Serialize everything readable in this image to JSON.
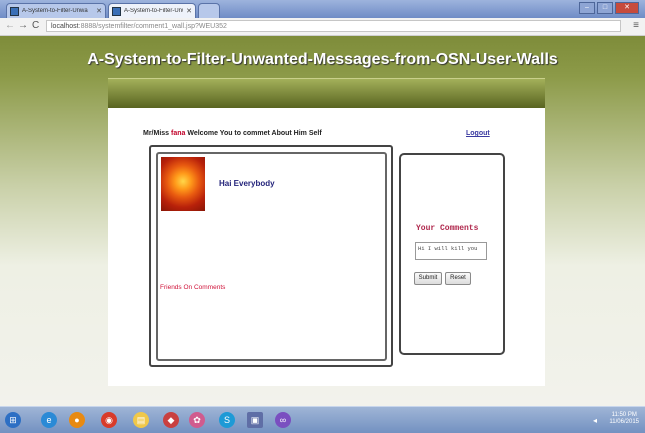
{
  "browser": {
    "tabs": [
      {
        "label": "A-System-to-Filter-Unwa"
      },
      {
        "label": "A-System-to-Filter-Unwa"
      },
      {
        "label": ""
      }
    ],
    "url_host": "localhost",
    "url_rest": ":8888/systemfilter/comment1_wall.jsp?WEU352"
  },
  "header": {
    "title": "A-System-to-Filter-Unwanted-Messages-from-OSN-User-Walls"
  },
  "welcome": {
    "prefix": "Mr/Miss ",
    "username": "fana",
    "message": " Welcome You to commet About Him Self",
    "logout_label": "Logout"
  },
  "post": {
    "text": "Hai Everybody",
    "friends_label": "Friends On Comments"
  },
  "comments": {
    "title": "Your Comments",
    "value": "Hi I will kill you",
    "submit_label": "Submit",
    "reset_label": "Reset"
  },
  "taskbar": {
    "time": "11:50 PM",
    "date": "11/06/2015"
  },
  "colors": {
    "username": "#c00028",
    "banner_top": "#a3b05a",
    "banner_bottom": "#56611e"
  }
}
